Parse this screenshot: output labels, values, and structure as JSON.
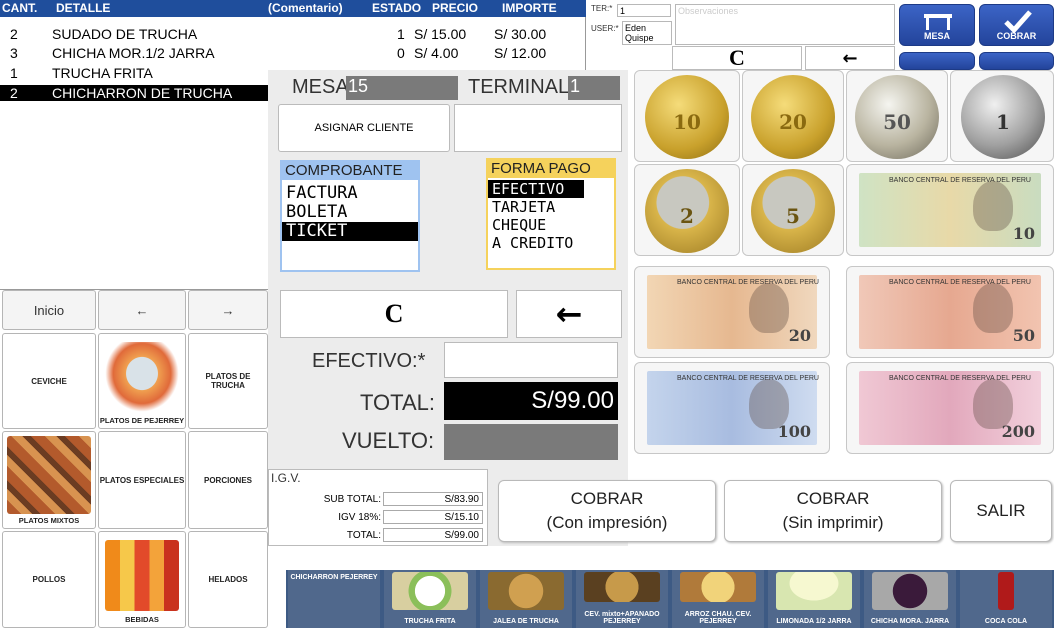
{
  "order": {
    "headers": {
      "cant": "CANT.",
      "detalle": "DETALLE",
      "comentario": "(Comentario)",
      "estado": "ESTADO",
      "precio": "PRECIO",
      "importe": "IMPORTE"
    },
    "rows": [
      {
        "cant": "2",
        "detalle": "SUDADO DE TRUCHA",
        "estado": "1",
        "precio": "S/ 15.00",
        "importe": "S/ 30.00"
      },
      {
        "cant": "3",
        "detalle": "CHICHA MOR.1/2 JARRA",
        "estado": "0",
        "precio": "S/ 4.00",
        "importe": "S/ 12.00"
      },
      {
        "cant": "1",
        "detalle": "TRUCHA FRITA",
        "estado": "",
        "precio": "",
        "importe": ""
      },
      {
        "cant": "2",
        "detalle": "CHICHARRON DE TRUCHA",
        "estado": "",
        "precio": "",
        "importe": ""
      }
    ]
  },
  "session": {
    "ter_label": "TER:*",
    "ter_value": "1",
    "user_label": "USER:*",
    "user_value": "Eden Quispe",
    "observations_placeholder": "Observaciones"
  },
  "keypad_top": {
    "clear": "C",
    "back": "←"
  },
  "top_buttons": {
    "mesa": "MESA",
    "cobrar": "COBRAR"
  },
  "nav": {
    "inicio": "Inicio",
    "prev": "←",
    "next": "→"
  },
  "categories": [
    {
      "label": "CEVICHE"
    },
    {
      "label": "PLATOS DE PEJERREY"
    },
    {
      "label": "PLATOS DE TRUCHA"
    },
    {
      "label": "PLATOS MIXTOS"
    },
    {
      "label": "PLATOS ESPECIALES"
    },
    {
      "label": "PORCIONES"
    },
    {
      "label": "POLLOS"
    },
    {
      "label": "BEBIDAS"
    },
    {
      "label": "HELADOS"
    }
  ],
  "payment": {
    "mesa_label": "MESA:",
    "mesa_value": "15",
    "terminal_label": "TERMINAL:",
    "terminal_value": "1",
    "assign_client": "ASIGNAR CLIENTE",
    "comprobante_title": "COMPROBANTE",
    "comprobante_options": [
      "FACTURA",
      "BOLETA",
      "TICKET"
    ],
    "forma_pago_title": "FORMA PAGO",
    "forma_pago_options": [
      "EFECTIVO",
      "TARJETA",
      "CHEQUE",
      "A CREDITO"
    ],
    "clear": "C",
    "back": "←",
    "efectivo_label": "EFECTIVO:*",
    "efectivo_value": "",
    "total_label": "TOTAL:",
    "total_value": "S/99.00",
    "vuelto_label": "VUELTO:",
    "vuelto_value": ""
  },
  "igv": {
    "title": "I.G.V.",
    "sub_total_label": "SUB TOTAL:",
    "sub_total": "S/83.90",
    "igv_label": "IGV 18%:",
    "igv": "S/15.10",
    "total_label": "TOTAL:",
    "total": "S/99.00"
  },
  "actions": {
    "cobrar_con_l1": "COBRAR",
    "cobrar_con_l2": "(Con impresión)",
    "cobrar_sin_l1": "COBRAR",
    "cobrar_sin_l2": "(Sin imprimir)",
    "salir": "SALIR"
  },
  "money": {
    "coins": [
      "10",
      "20",
      "50",
      "1",
      "2",
      "5"
    ],
    "bills": [
      "10",
      "20",
      "50",
      "100",
      "200"
    ],
    "bank_text": "BANCO CENTRAL DE RESERVA DEL PERU"
  },
  "products": [
    {
      "label": "CHICHARRON PEJERREY"
    },
    {
      "label": "TRUCHA FRITA"
    },
    {
      "label": "JALEA DE TRUCHA"
    },
    {
      "label": "CEV. mixto+APANADO PEJERREY"
    },
    {
      "label": "ARROZ CHAU. CEV. PEJERREY"
    },
    {
      "label": "LIMONADA 1/2 JARRA"
    },
    {
      "label": "CHICHA MORA. JARRA"
    },
    {
      "label": "COCA COLA"
    }
  ],
  "colors": {
    "header_blue": "#1f4e9c",
    "strip_blue": "#3d5a84",
    "list_head": "#9fc3f0",
    "forma_head": "#f5d25c"
  }
}
